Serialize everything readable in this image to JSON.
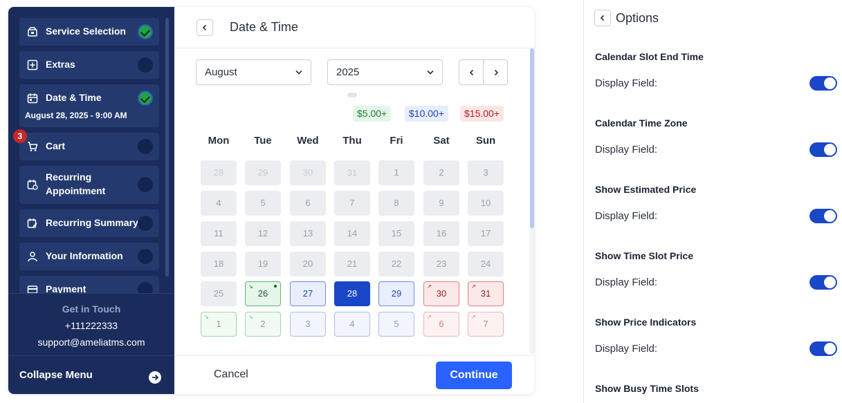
{
  "sidebar": {
    "steps": [
      {
        "label": "Service Selection",
        "done": true
      },
      {
        "label": "Extras",
        "done": false
      },
      {
        "label": "Date & Time",
        "done": true,
        "sub": "August 28, 2025 - 9:00 AM"
      },
      {
        "label": "Cart",
        "done": false,
        "badge": "3"
      },
      {
        "label": "Recurring Appointment",
        "line1": "Recurring",
        "line2": "Appointment",
        "done": false
      },
      {
        "label": "Recurring Summary",
        "done": false
      },
      {
        "label": "Your Information",
        "done": false
      },
      {
        "label": "Payment",
        "done": false
      }
    ],
    "contact": {
      "heading": "Get in Touch",
      "phone": "+111222333",
      "email": "support@ameliatms.com"
    },
    "collapse_label": "Collapse Menu"
  },
  "main": {
    "title": "Date & Time",
    "month": "August",
    "year": "2025",
    "prices": [
      "$5.00+",
      "$10.00+",
      "$15.00+"
    ],
    "weekdays": [
      "Mon",
      "Tue",
      "Wed",
      "Thu",
      "Fri",
      "Sat",
      "Sun"
    ],
    "days": [
      [
        "28",
        "29",
        "30",
        "31",
        "1",
        "2",
        "3"
      ],
      [
        "4",
        "5",
        "6",
        "7",
        "8",
        "9",
        "10"
      ],
      [
        "11",
        "12",
        "13",
        "14",
        "15",
        "16",
        "17"
      ],
      [
        "18",
        "19",
        "20",
        "21",
        "22",
        "23",
        "24"
      ],
      [
        "25",
        "26",
        "27",
        "28",
        "29",
        "30",
        "31"
      ],
      [
        "1",
        "2",
        "3",
        "4",
        "5",
        "6",
        "7"
      ]
    ],
    "selected_day": "28",
    "cancel_label": "Cancel",
    "continue_label": "Continue"
  },
  "options": {
    "title": "Options",
    "items": [
      {
        "title": "Calendar Slot End Time",
        "field": "Display Field:",
        "on": true
      },
      {
        "title": "Calendar Time Zone",
        "field": "Display Field:",
        "on": true
      },
      {
        "title": "Show Estimated Price",
        "field": "Display Field:",
        "on": true
      },
      {
        "title": "Show Time Slot Price",
        "field": "Display Field:",
        "on": true
      },
      {
        "title": "Show Price Indicators",
        "field": "Display Field:",
        "on": true
      },
      {
        "title": "Show Busy Time Slots"
      }
    ]
  },
  "colors": {
    "sidebar": "#1a2c5b",
    "accent": "#2962ff",
    "selected": "#1a46c8",
    "green": "#1fa24a",
    "badge": "#c62828"
  }
}
